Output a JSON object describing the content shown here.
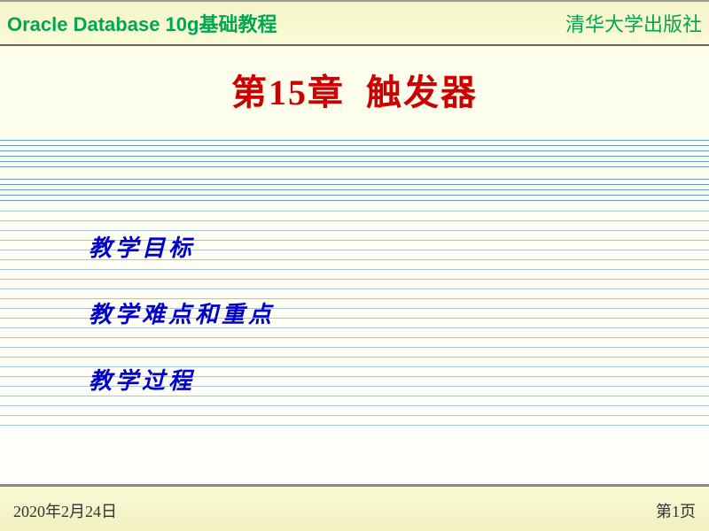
{
  "header": {
    "course_title": "Oracle Database 10g基础教程",
    "publisher": "清华大学出版社"
  },
  "chapter": {
    "prefix": "第",
    "number": "15",
    "suffix": "章",
    "topic": "触发器"
  },
  "content_items": [
    "教学目标",
    "教学难点和重点",
    "教学过程"
  ],
  "footer": {
    "date": "2020年2月24日",
    "page": "第1页"
  }
}
